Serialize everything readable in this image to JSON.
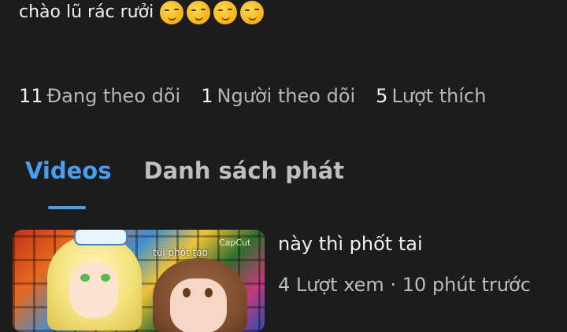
{
  "bio": {
    "text": "chào lũ rác rưởi",
    "emoji": [
      "smirking-face",
      "smirking-face",
      "smirking-face",
      "smirking-face"
    ]
  },
  "stats": [
    {
      "count": "11",
      "label": "Đang theo dõi"
    },
    {
      "count": "1",
      "label": "Người theo dõi"
    },
    {
      "count": "5",
      "label": "Lượt thích"
    }
  ],
  "tabs": [
    {
      "label": "Videos",
      "active": true
    },
    {
      "label": "Danh sách phát",
      "active": false
    }
  ],
  "colors": {
    "background": "#1c1c1c",
    "accent": "#4a9ef0"
  },
  "video": {
    "thumbnail_overlay": "tui phốt tao",
    "thumbnail_watermark": "CapCut",
    "title": "này thì phốt tai",
    "views": "4 Lượt xem",
    "separator": " · ",
    "time": "10 phút trước"
  }
}
